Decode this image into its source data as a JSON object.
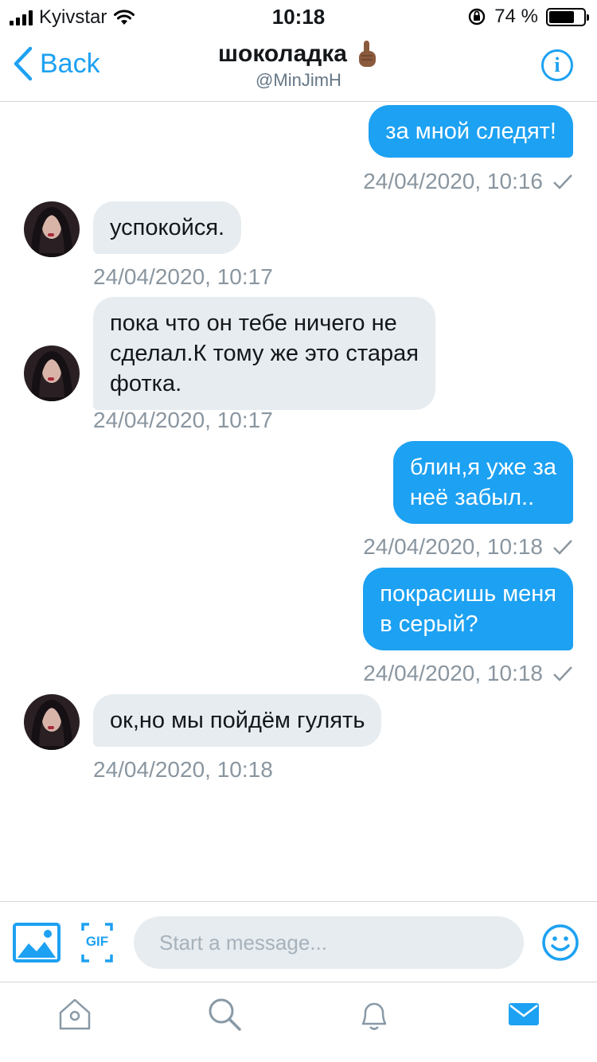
{
  "status_bar": {
    "carrier": "Kyivstar",
    "time": "10:18",
    "battery": "74 %",
    "battery_level": 0.74
  },
  "nav": {
    "back_label": "Back",
    "name": "шоколадка",
    "name_emoji": "pointing-up-emoji",
    "handle": "@MinJimH"
  },
  "messages": [
    {
      "direction": "out",
      "text": "за мной следят!",
      "timestamp": "24/04/2020, 10:16",
      "read_check": true
    },
    {
      "direction": "in",
      "text": "успокойся.",
      "timestamp": "24/04/2020, 10:17"
    },
    {
      "direction": "in",
      "lines": [
        "пока что он тебе ничего не",
        "сделал.К тому же это старая",
        "фотка."
      ],
      "timestamp": "24/04/2020, 10:17"
    },
    {
      "direction": "out",
      "lines": [
        "блин,я уже за",
        "неё забыл.."
      ],
      "timestamp": "24/04/2020, 10:18",
      "read_check": true
    },
    {
      "direction": "out",
      "lines": [
        "покрасишь меня",
        "в серый?"
      ],
      "timestamp": "24/04/2020, 10:18",
      "read_check": true
    },
    {
      "direction": "in",
      "text": "ок,но мы пойдём гулять",
      "timestamp": "24/04/2020, 10:18"
    }
  ],
  "composer": {
    "placeholder": "Start a message...",
    "gif_label": "GIF"
  },
  "tabs": [
    {
      "name": "home-icon",
      "active": false
    },
    {
      "name": "search-icon",
      "active": false
    },
    {
      "name": "notifications-icon",
      "active": false
    },
    {
      "name": "messages-icon",
      "active": true
    }
  ],
  "colors": {
    "accent": "#1da1f2",
    "incoming_bubble": "#e6ecf0",
    "timestamp": "#8a96a0",
    "tab_inactive": "#8899a6"
  }
}
